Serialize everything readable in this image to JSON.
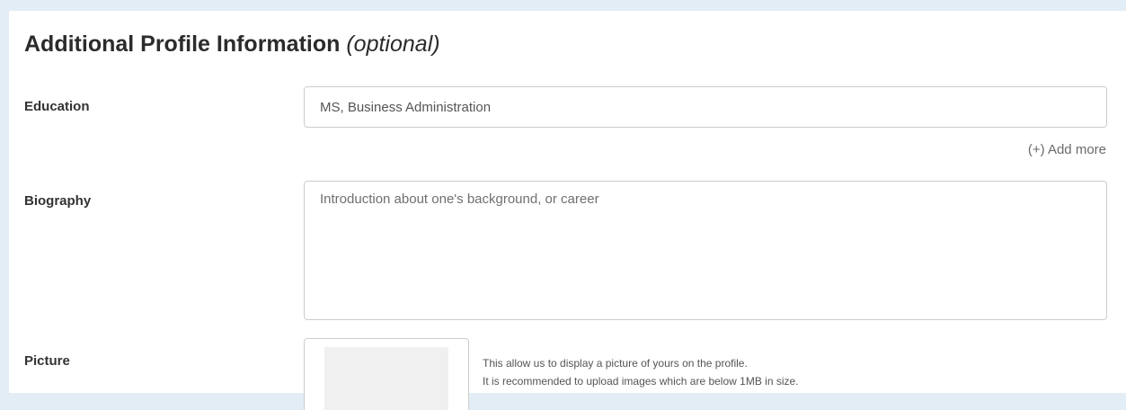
{
  "section": {
    "title": "Additional Profile Information",
    "title_suffix": "(optional)"
  },
  "education": {
    "label": "Education",
    "value": "MS, Business Administration",
    "add_more": "(+) Add more"
  },
  "biography": {
    "label": "Biography",
    "placeholder": "Introduction about one's background, or career"
  },
  "picture": {
    "label": "Picture",
    "help_line1": "This allow us to display a picture of yours on the profile.",
    "help_line2": "It is recommended to upload images which are below 1MB in size."
  }
}
